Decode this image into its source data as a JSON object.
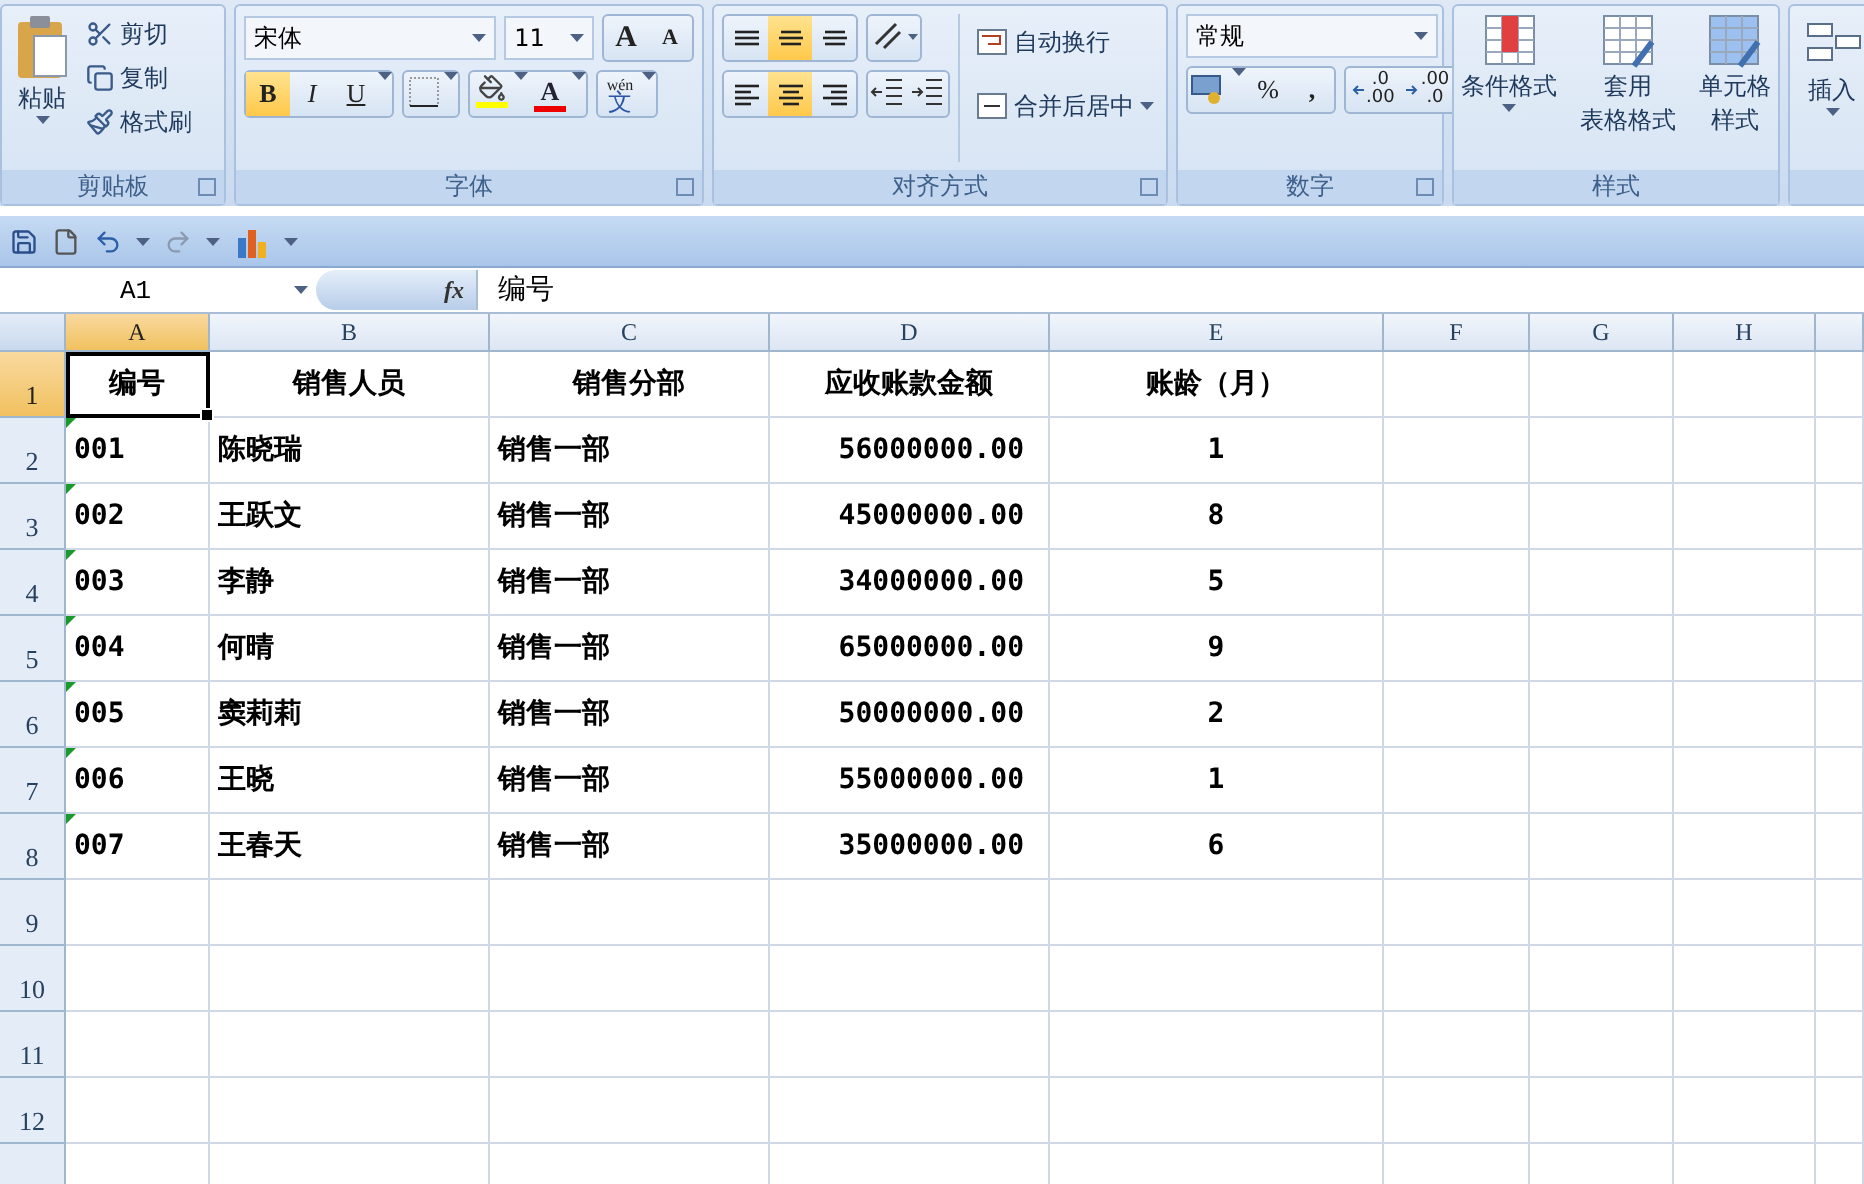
{
  "ribbon": {
    "clipboard": {
      "label": "剪贴板",
      "paste": "粘贴",
      "actions": [
        {
          "kind": "cut",
          "label": "剪切"
        },
        {
          "kind": "copy",
          "label": "复制"
        },
        {
          "kind": "painter",
          "label": "格式刷"
        }
      ]
    },
    "font": {
      "label": "字体",
      "font_name": "宋体",
      "font_size": "11",
      "grow": "A",
      "shrink": "A",
      "styles": [
        {
          "kind": "bold",
          "label": "B",
          "active": true
        },
        {
          "kind": "italic",
          "label": "I",
          "active": false
        },
        {
          "kind": "underline",
          "label": "U",
          "active": false
        }
      ],
      "font_color_label": "A",
      "phonetic": {
        "ruby": "wén",
        "base": "文"
      }
    },
    "alignment": {
      "label": "对齐方式",
      "vertical": [
        {
          "kind": "top",
          "active": false
        },
        {
          "kind": "middle",
          "active": true
        },
        {
          "kind": "bottom",
          "active": false
        }
      ],
      "horizontal": [
        {
          "kind": "left",
          "active": false
        },
        {
          "kind": "center",
          "active": true
        },
        {
          "kind": "right",
          "active": false
        }
      ],
      "wrap": "自动换行",
      "merge": "合并后居中"
    },
    "number": {
      "label": "数字",
      "format": "常规",
      "percent": "%",
      "comma": ",",
      "decimals": [
        {
          "kind": "increase",
          "top": ".0",
          "bottom": ".00"
        },
        {
          "kind": "decrease",
          "top": ".00",
          "bottom": ".0"
        }
      ]
    },
    "styles": {
      "label": "样式",
      "buttons": [
        {
          "kind": "conditional",
          "lines": [
            "条件格式"
          ]
        },
        {
          "kind": "table",
          "lines": [
            "套用",
            "表格格式"
          ]
        },
        {
          "kind": "cell",
          "lines": [
            "单元格",
            "样式"
          ]
        }
      ]
    },
    "cells": {
      "insert": "插入"
    }
  },
  "formula_bar": {
    "name_box": "A1",
    "fx": "fx",
    "content": "编号"
  },
  "sheet": {
    "columns": [
      {
        "label": "A",
        "selected": true
      },
      {
        "label": "B",
        "selected": false
      },
      {
        "label": "C",
        "selected": false
      },
      {
        "label": "D",
        "selected": false
      },
      {
        "label": "E",
        "selected": false
      },
      {
        "label": "F",
        "selected": false
      },
      {
        "label": "G",
        "selected": false
      },
      {
        "label": "H",
        "selected": false
      }
    ],
    "rows": [
      {
        "label": "1",
        "selected": true,
        "kind": "header",
        "text_flag": false,
        "cells": [
          "编号",
          "销售人员",
          "销售分部",
          "应收账款金额",
          "账龄（月）"
        ]
      },
      {
        "label": "2",
        "selected": false,
        "kind": "data",
        "text_flag": true,
        "cells": [
          "001",
          "陈晓瑞",
          "销售一部",
          "56000000.00",
          "1"
        ]
      },
      {
        "label": "3",
        "selected": false,
        "kind": "data",
        "text_flag": true,
        "cells": [
          "002",
          "王跃文",
          "销售一部",
          "45000000.00",
          "8"
        ]
      },
      {
        "label": "4",
        "selected": false,
        "kind": "data",
        "text_flag": true,
        "cells": [
          "003",
          "李静",
          "销售一部",
          "34000000.00",
          "5"
        ]
      },
      {
        "label": "5",
        "selected": false,
        "kind": "data",
        "text_flag": true,
        "cells": [
          "004",
          "何晴",
          "销售一部",
          "65000000.00",
          "9"
        ]
      },
      {
        "label": "6",
        "selected": false,
        "kind": "data",
        "text_flag": true,
        "cells": [
          "005",
          "窦莉莉",
          "销售一部",
          "50000000.00",
          "2"
        ]
      },
      {
        "label": "7",
        "selected": false,
        "kind": "data",
        "text_flag": true,
        "cells": [
          "006",
          "王晓",
          "销售一部",
          "55000000.00",
          "1"
        ]
      },
      {
        "label": "8",
        "selected": false,
        "kind": "data",
        "text_flag": true,
        "cells": [
          "007",
          "王春天",
          "销售一部",
          "35000000.00",
          "6"
        ]
      },
      {
        "label": "9",
        "selected": false,
        "kind": "data",
        "text_flag": false,
        "cells": []
      },
      {
        "label": "10",
        "selected": false,
        "kind": "data",
        "text_flag": false,
        "cells": []
      },
      {
        "label": "11",
        "selected": false,
        "kind": "data",
        "text_flag": false,
        "cells": []
      },
      {
        "label": "12",
        "selected": false,
        "kind": "data",
        "text_flag": false,
        "cells": []
      }
    ]
  }
}
